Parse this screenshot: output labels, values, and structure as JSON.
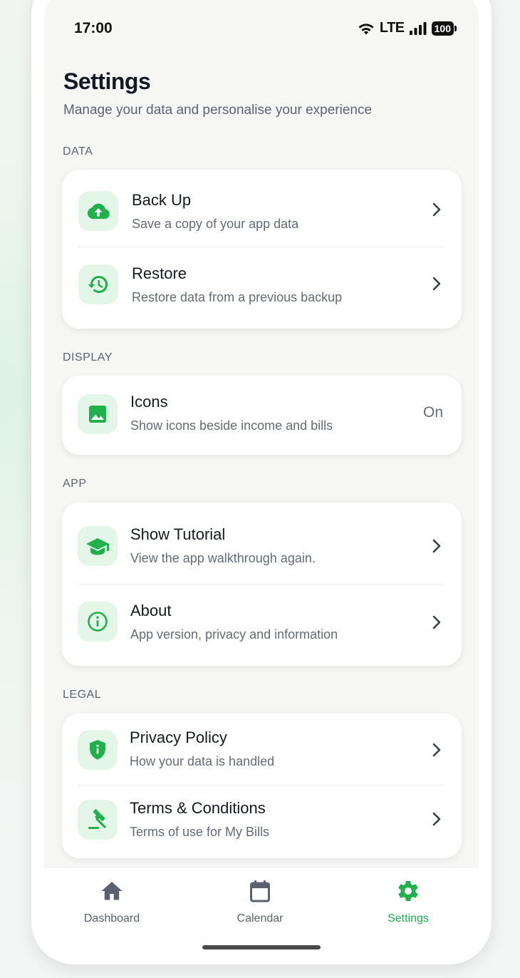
{
  "status_bar": {
    "time": "17:00",
    "network": "LTE",
    "battery": "100"
  },
  "header": {
    "title": "Settings",
    "subtitle": "Manage your data and personalise your experience"
  },
  "sections": {
    "data": {
      "label": "DATA",
      "items": [
        {
          "title": "Back Up",
          "subtitle": "Save a copy of your app data",
          "icon": "cloud-upload-icon"
        },
        {
          "title": "Restore",
          "subtitle": "Restore data from a previous backup",
          "icon": "history-icon"
        }
      ]
    },
    "display": {
      "label": "DISPLAY",
      "items": [
        {
          "title": "Icons",
          "subtitle": "Show icons beside income and bills",
          "value": "On",
          "icon": "image-icon"
        }
      ]
    },
    "app": {
      "label": "APP",
      "items": [
        {
          "title": "Show Tutorial",
          "subtitle": "View the app walkthrough again.",
          "icon": "graduation-cap-icon"
        },
        {
          "title": "About",
          "subtitle": "App version, privacy and information",
          "icon": "info-icon"
        }
      ]
    },
    "legal": {
      "label": "LEGAL",
      "items": [
        {
          "title": "Privacy Policy",
          "subtitle": "How your data is handled",
          "icon": "shield-icon"
        },
        {
          "title": "Terms & Conditions",
          "subtitle": "Terms of use for My Bills",
          "icon": "gavel-icon"
        }
      ]
    }
  },
  "bottom_nav": {
    "items": [
      {
        "label": "Dashboard",
        "icon": "home-icon",
        "active": false
      },
      {
        "label": "Calendar",
        "icon": "calendar-icon",
        "active": false
      },
      {
        "label": "Settings",
        "icon": "gear-icon",
        "active": true
      }
    ]
  },
  "colors": {
    "accent": "#1fb14b",
    "icon_bg": "#e3f6e7",
    "text_primary": "#151a21",
    "text_secondary": "#646b76"
  }
}
